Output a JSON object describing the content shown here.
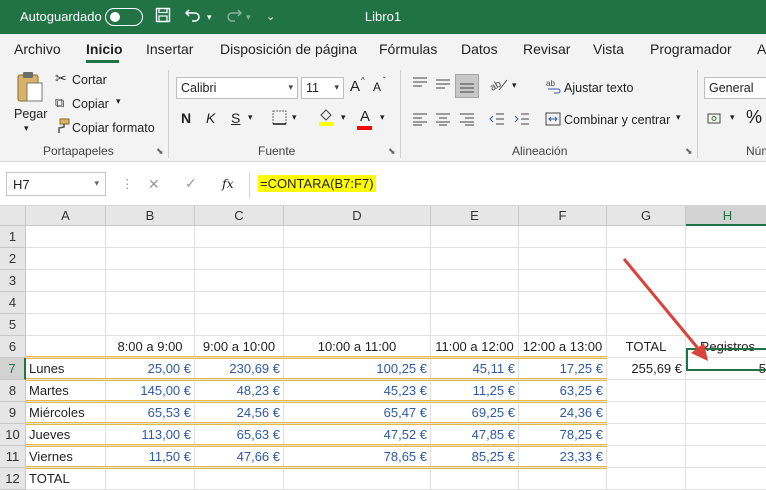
{
  "titlebar": {
    "autosave_label": "Autoguardado",
    "doc_title": "Libro1",
    "icons": [
      "save-icon",
      "undo-icon",
      "redo-icon"
    ]
  },
  "menu": {
    "items": [
      "Archivo",
      "Inicio",
      "Insertar",
      "Disposición de página",
      "Fórmulas",
      "Datos",
      "Revisar",
      "Vista",
      "Programador",
      "A"
    ],
    "active": "Inicio"
  },
  "ribbon": {
    "clipboard": {
      "paste": "Pegar",
      "cut": "Cortar",
      "copy": "Copiar",
      "format_painter": "Copiar formato",
      "group": "Portapapeles"
    },
    "font": {
      "family": "Calibri",
      "size": "11",
      "bold": "N",
      "italic": "K",
      "underline": "S",
      "grow": "A",
      "shrink": "A",
      "color_letter": "A",
      "group": "Fuente",
      "highlight_color": "#ffff00",
      "font_color": "#ff0000"
    },
    "alignment": {
      "wrap": "Ajustar texto",
      "merge": "Combinar y centrar",
      "group": "Alineación"
    },
    "number": {
      "format": "General",
      "percent": "%",
      "group": "Núm"
    }
  },
  "formula_bar": {
    "name_box": "H7",
    "fx": "fx",
    "formula": "=CONTARA(B7:F7)"
  },
  "sheet": {
    "columns": [
      "A",
      "B",
      "C",
      "D",
      "E",
      "F",
      "G",
      "H"
    ],
    "rows": [
      "1",
      "2",
      "3",
      "4",
      "5",
      "6",
      "7",
      "8",
      "9",
      "10",
      "11",
      "12"
    ],
    "header_row": {
      "b": "8:00 a 9:00",
      "c": "9:00 a 10:00",
      "d": "10:00 a 11:00",
      "e": "11:00 a 12:00",
      "f": "12:00 a 13:00",
      "g": "TOTAL",
      "h": "Registros"
    },
    "data": [
      {
        "day": "Lunes",
        "b": "25,00 €",
        "c": "230,69 €",
        "d": "100,25 €",
        "e": "45,11 €",
        "f": "17,25 €",
        "g": "255,69 €",
        "h": "5"
      },
      {
        "day": "Martes",
        "b": "145,00 €",
        "c": "48,23 €",
        "d": "45,23 €",
        "e": "11,25 €",
        "f": "63,25 €"
      },
      {
        "day": "Miércoles",
        "b": "65,53 €",
        "c": "24,56 €",
        "d": "65,47 €",
        "e": "69,25 €",
        "f": "24,36 €"
      },
      {
        "day": "Jueves",
        "b": "113,00 €",
        "c": "65,63 €",
        "d": "47,52 €",
        "e": "47,85 €",
        "f": "78,25 €"
      },
      {
        "day": "Viernes",
        "b": "11,50 €",
        "c": "47,66 €",
        "d": "78,65 €",
        "e": "85,25 €",
        "f": "23,33 €"
      }
    ],
    "total_label": "TOTAL",
    "selected_cell": "H7"
  },
  "colors": {
    "brand": "#217346",
    "value_text": "#2e5aa6",
    "formula_highlight": "#ffff00",
    "row_border": "#e7b93f",
    "arrow": "#d9433b"
  }
}
